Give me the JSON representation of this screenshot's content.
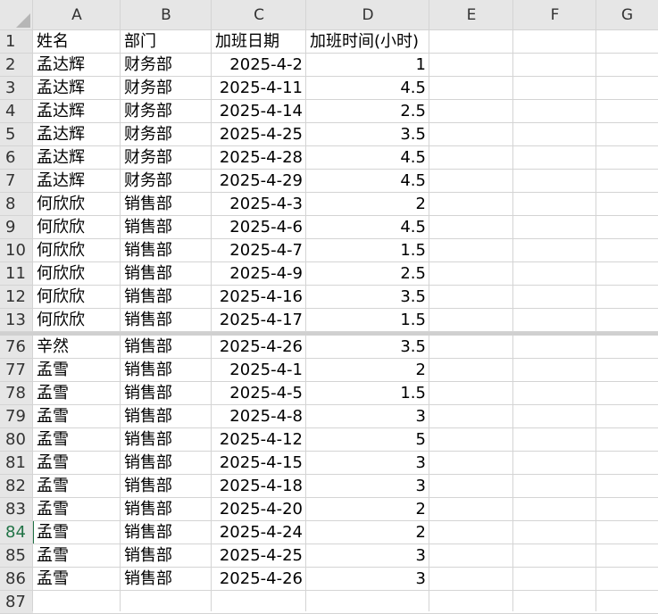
{
  "columns": [
    "A",
    "B",
    "C",
    "D",
    "E",
    "F",
    "G"
  ],
  "selected_row": "84",
  "rows": [
    {
      "num": "1",
      "cells": [
        "姓名",
        "部门",
        "加班日期",
        "加班时间(小时)"
      ],
      "header": true
    },
    {
      "num": "2",
      "cells": [
        "孟达辉",
        "财务部",
        "2025-4-2",
        "1"
      ]
    },
    {
      "num": "3",
      "cells": [
        "孟达辉",
        "财务部",
        "2025-4-11",
        "4.5"
      ]
    },
    {
      "num": "4",
      "cells": [
        "孟达辉",
        "财务部",
        "2025-4-14",
        "2.5"
      ]
    },
    {
      "num": "5",
      "cells": [
        "孟达辉",
        "财务部",
        "2025-4-25",
        "3.5"
      ]
    },
    {
      "num": "6",
      "cells": [
        "孟达辉",
        "财务部",
        "2025-4-28",
        "4.5"
      ]
    },
    {
      "num": "7",
      "cells": [
        "孟达辉",
        "财务部",
        "2025-4-29",
        "4.5"
      ]
    },
    {
      "num": "8",
      "cells": [
        "何欣欣",
        "销售部",
        "2025-4-3",
        "2"
      ]
    },
    {
      "num": "9",
      "cells": [
        "何欣欣",
        "销售部",
        "2025-4-6",
        "4.5"
      ]
    },
    {
      "num": "10",
      "cells": [
        "何欣欣",
        "销售部",
        "2025-4-7",
        "1.5"
      ]
    },
    {
      "num": "11",
      "cells": [
        "何欣欣",
        "销售部",
        "2025-4-9",
        "2.5"
      ]
    },
    {
      "num": "12",
      "cells": [
        "何欣欣",
        "销售部",
        "2025-4-16",
        "3.5"
      ]
    },
    {
      "num": "13",
      "cells": [
        "何欣欣",
        "销售部",
        "2025-4-17",
        "1.5"
      ]
    },
    {
      "num": "76",
      "cells": [
        "辛然",
        "销售部",
        "2025-4-26",
        "3.5"
      ]
    },
    {
      "num": "77",
      "cells": [
        "孟雪",
        "销售部",
        "2025-4-1",
        "2"
      ]
    },
    {
      "num": "78",
      "cells": [
        "孟雪",
        "销售部",
        "2025-4-5",
        "1.5"
      ]
    },
    {
      "num": "79",
      "cells": [
        "孟雪",
        "销售部",
        "2025-4-8",
        "3"
      ]
    },
    {
      "num": "80",
      "cells": [
        "孟雪",
        "销售部",
        "2025-4-12",
        "5"
      ]
    },
    {
      "num": "81",
      "cells": [
        "孟雪",
        "销售部",
        "2025-4-15",
        "3"
      ]
    },
    {
      "num": "82",
      "cells": [
        "孟雪",
        "销售部",
        "2025-4-18",
        "3"
      ]
    },
    {
      "num": "83",
      "cells": [
        "孟雪",
        "销售部",
        "2025-4-20",
        "2"
      ]
    },
    {
      "num": "84",
      "cells": [
        "孟雪",
        "销售部",
        "2025-4-24",
        "2"
      ]
    },
    {
      "num": "85",
      "cells": [
        "孟雪",
        "销售部",
        "2025-4-25",
        "3"
      ]
    },
    {
      "num": "86",
      "cells": [
        "孟雪",
        "销售部",
        "2025-4-26",
        "3"
      ]
    },
    {
      "num": "87",
      "cells": [
        "",
        "",
        "",
        ""
      ]
    }
  ],
  "colors": {
    "header_bg": "#e6e6e6",
    "gridline": "#d4d4d4",
    "selected_row_header": "#217346"
  }
}
